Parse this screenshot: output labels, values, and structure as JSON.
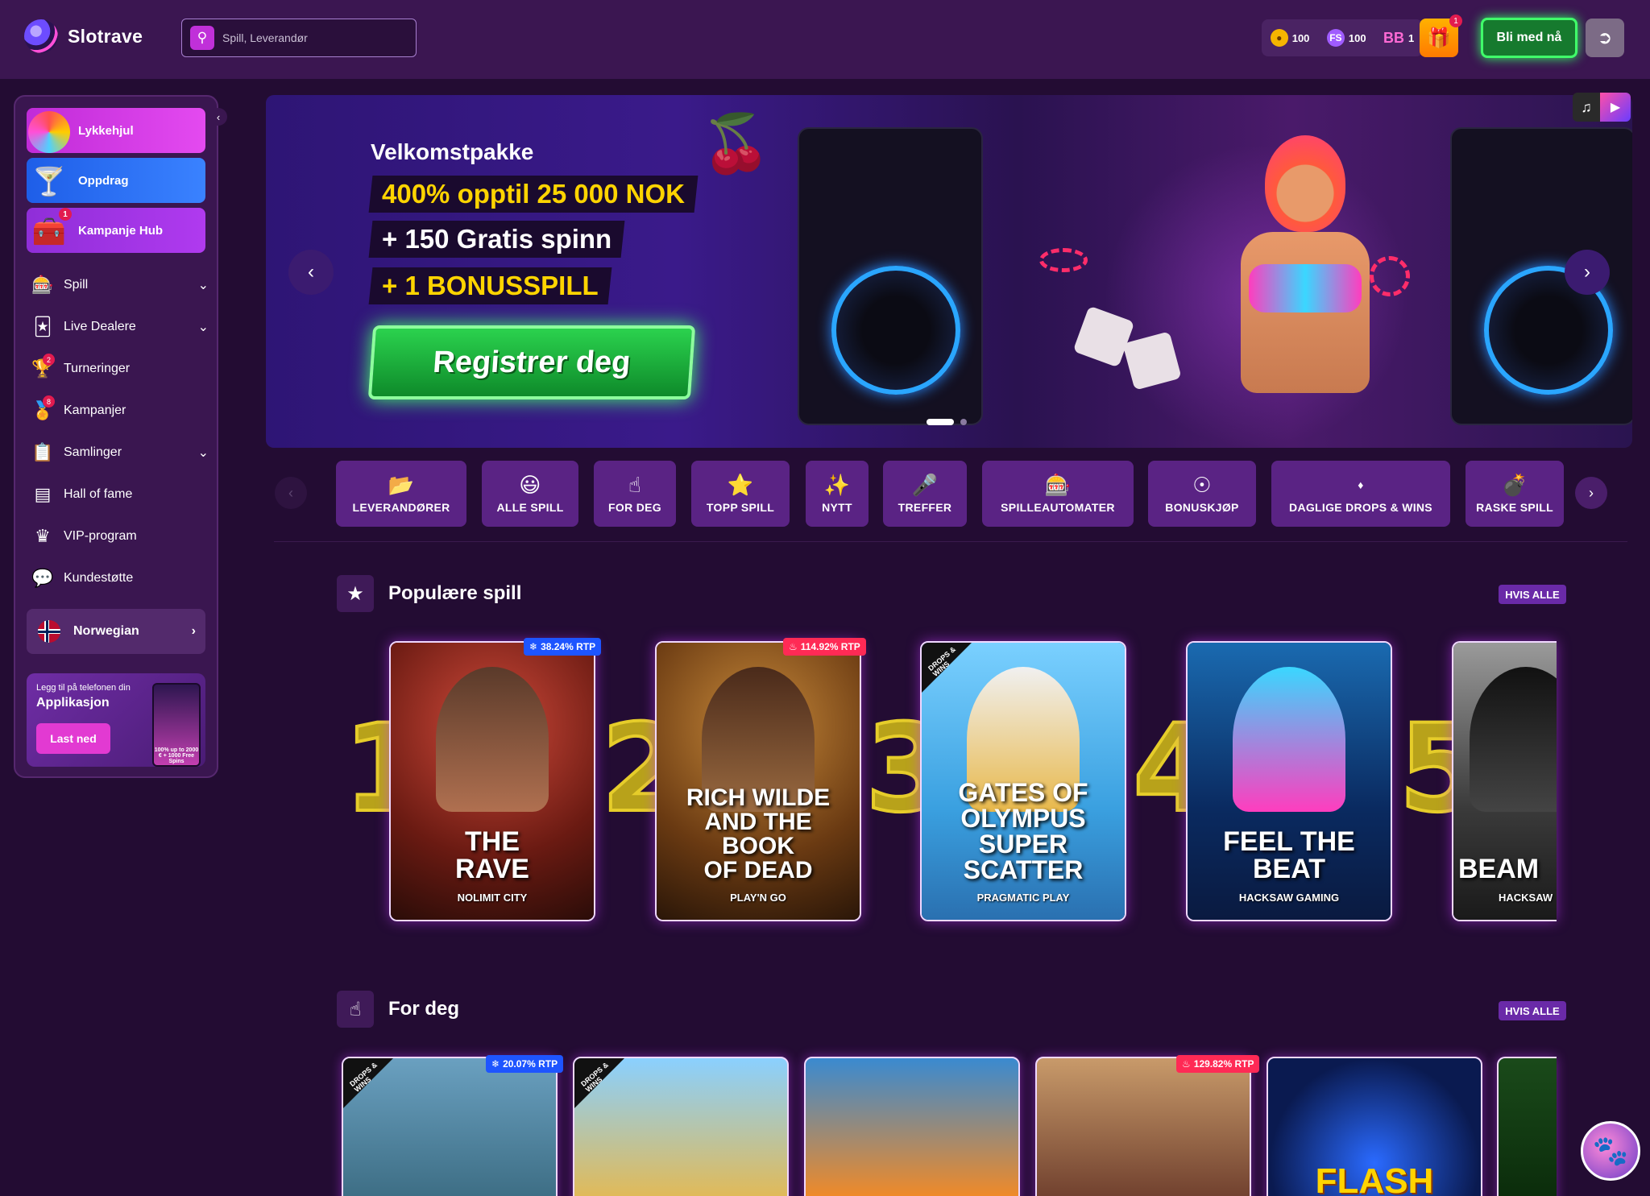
{
  "header": {
    "brand": "Slotrave",
    "search_placeholder": "Spill, Leverandør",
    "wallet": [
      {
        "icon": "coin-icon",
        "value": "100",
        "color": "#f5b400"
      },
      {
        "icon": "free-spins-icon",
        "value": "100",
        "color": "#a05cff",
        "label": "FS"
      },
      {
        "icon": "bonus-buy-icon",
        "value": "1",
        "color": "#ff6ad5",
        "label": "BB"
      }
    ],
    "gift_badge": "1",
    "join_label": "Bli med nå"
  },
  "sidebar": {
    "promos": [
      {
        "label": "Lykkehjul",
        "icon": "wheel-icon",
        "color": "#d13ad8"
      },
      {
        "label": "Oppdrag",
        "icon": "cocktail-icon",
        "color": "#2f6ef0"
      },
      {
        "label": "Kampanje Hub",
        "icon": "treasure-chest-icon",
        "color": "#9b30e0",
        "badge": "1"
      }
    ],
    "nav": [
      {
        "label": "Spill",
        "icon": "slot-machine-icon",
        "expandable": true
      },
      {
        "label": "Live Dealere",
        "icon": "cards-icon",
        "expandable": true
      },
      {
        "label": "Turneringer",
        "icon": "trophy-icon",
        "badge": "2"
      },
      {
        "label": "Kampanjer",
        "icon": "medal-icon",
        "badge": "8"
      },
      {
        "label": "Samlinger",
        "icon": "collection-icon",
        "expandable": true
      },
      {
        "label": "Hall of fame",
        "icon": "podium-icon"
      },
      {
        "label": "VIP-program",
        "icon": "crown-icon"
      },
      {
        "label": "Kundestøtte",
        "icon": "support-chat-icon"
      }
    ],
    "language": "Norwegian",
    "app_card": {
      "line1": "Legg til på telefonen din",
      "line2": "Applikasjon",
      "button": "Last ned",
      "phone_text": "100% up to 2000 € + 1000 Free Spins"
    }
  },
  "hero": {
    "title": "Velkomstpakke",
    "lines": [
      "400% opptil 25 000 NOK",
      "+ 150 Gratis spinn",
      "+ 1 BONUSSPILL"
    ],
    "cta": "Registrer deg",
    "slides": 2,
    "active_slide": 1
  },
  "categories": [
    {
      "label": "LEVERANDØRER",
      "icon": "folder-icon"
    },
    {
      "label": "ALLE SPILL",
      "icon": "smiley-icon"
    },
    {
      "label": "FOR DEG",
      "icon": "pointing-hand-icon"
    },
    {
      "label": "TOPP SPILL",
      "icon": "star-icon"
    },
    {
      "label": "NYTT",
      "icon": "sparkle-icon"
    },
    {
      "label": "TREFFER",
      "icon": "microphone-icon"
    },
    {
      "label": "SPILLEAUTOMATER",
      "icon": "slot-machine-icon"
    },
    {
      "label": "BONUSKJØP",
      "icon": "dollar-coin-icon"
    },
    {
      "label": "DAGLIGE DROPS & WINS",
      "icon": "drops-wins-icon"
    },
    {
      "label": "RASKE SPILL",
      "icon": "bomb-icon"
    }
  ],
  "popular": {
    "title": "Populære spill",
    "see_all": "HVIS ALLE",
    "games": [
      {
        "rank": "1",
        "name": "THE\nRAVE",
        "provider": "NOLIMIT CITY",
        "rtp": "38.24% RTP",
        "rtp_kind": "cold"
      },
      {
        "rank": "2",
        "name": "RICH WILDE\nAND THE\nBOOK\nOF DEAD",
        "provider": "PLAY'N GO",
        "rtp": "114.92% RTP",
        "rtp_kind": "hot"
      },
      {
        "rank": "3",
        "name": "GATES OF\nOLYMPUS\nSUPER SCATTER",
        "provider": "PRAGMATIC PLAY",
        "drops": true
      },
      {
        "rank": "4",
        "name": "FEEL THE\nBEAT",
        "provider": "HACKSAW GAMING"
      },
      {
        "rank": "5",
        "name": "BEAM",
        "provider": "HACKSAW"
      }
    ]
  },
  "for_you": {
    "title": "For deg",
    "see_all": "HVIS ALLE",
    "games": [
      {
        "rtp": "20.07% RTP",
        "rtp_kind": "cold",
        "drops": true
      },
      {
        "drops": true
      },
      {},
      {
        "rtp": "129.82% RTP",
        "rtp_kind": "hot"
      },
      {
        "name": "FLASH"
      },
      {}
    ]
  },
  "drops_label": "DROPS & WINS"
}
